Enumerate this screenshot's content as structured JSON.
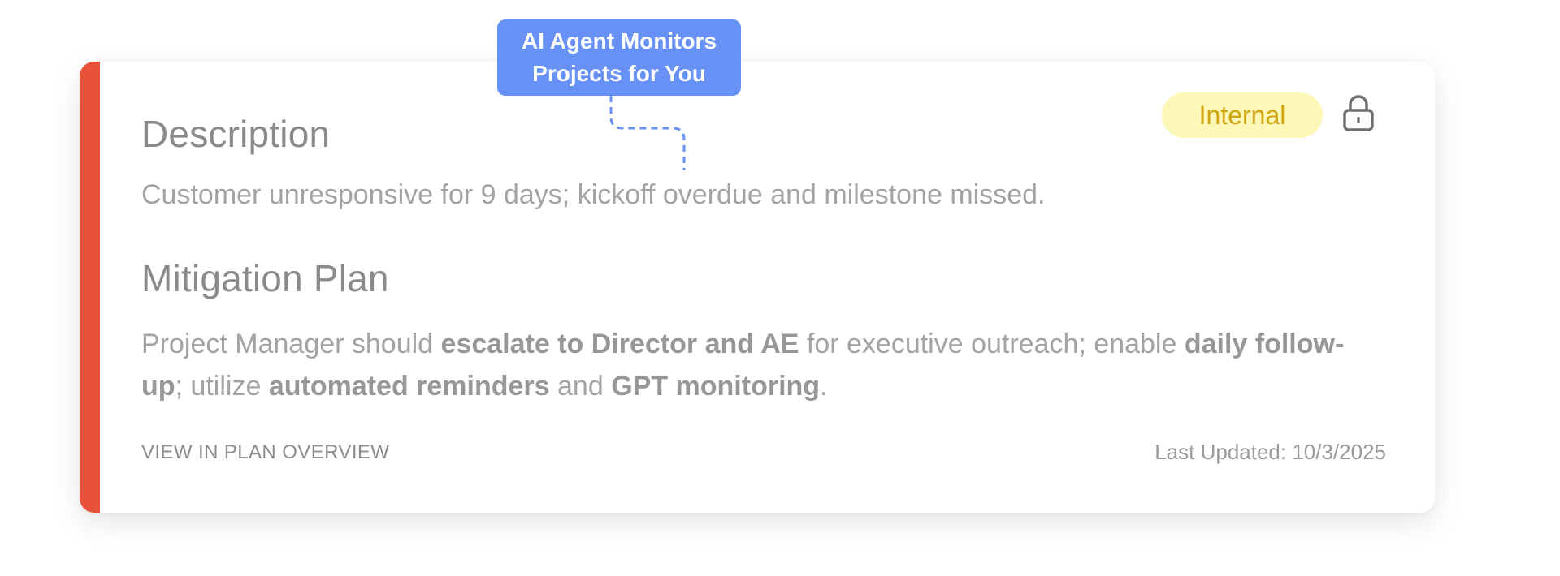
{
  "callout": {
    "line1": "AI Agent Monitors",
    "line2": "Projects for You"
  },
  "card": {
    "accent_color": "#e8513a",
    "badge": "Internal",
    "lock_icon": "lock-icon",
    "description": {
      "title": "Description",
      "text": "Customer unresponsive for 9 days; kickoff overdue and milestone missed."
    },
    "mitigation": {
      "title": "Mitigation Plan",
      "segments": [
        {
          "text": "Project Manager should ",
          "bold": false
        },
        {
          "text": "escalate to Director and AE",
          "bold": true
        },
        {
          "text": " for executive outreach; enable ",
          "bold": false
        },
        {
          "text": "daily follow-up",
          "bold": true
        },
        {
          "text": "; utilize ",
          "bold": false
        },
        {
          "text": "automated reminders",
          "bold": true
        },
        {
          "text": " and ",
          "bold": false
        },
        {
          "text": "GPT monitoring",
          "bold": true
        },
        {
          "text": ".",
          "bold": false
        }
      ]
    },
    "link": "VIEW IN PLAN OVERVIEW",
    "last_updated": "Last Updated: 10/3/2025"
  },
  "colors": {
    "callout_bg": "#6891f6",
    "badge_bg": "#fdf7b8",
    "badge_text": "#cfa40f"
  }
}
